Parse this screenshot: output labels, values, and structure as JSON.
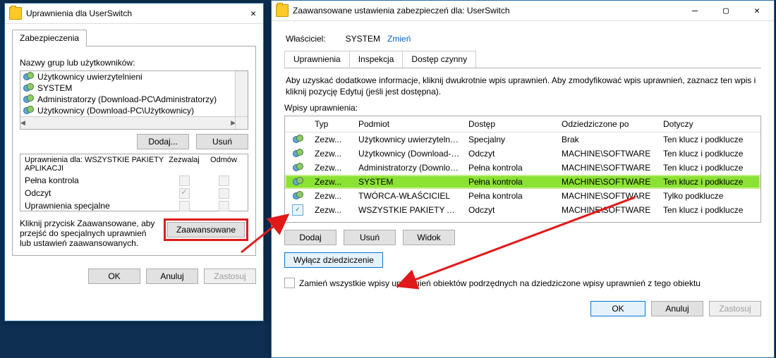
{
  "win1": {
    "title": "Uprawnienia dla UserSwitch",
    "tab": "Zabezpieczenia",
    "groups_label": "Nazwy grup lub użytkowników:",
    "groups": [
      "Użytkownicy uwierzytelnieni",
      "SYSTEM",
      "Administratorzy (Download-PC\\Administratorzy)",
      "Użytkownicy (Download-PC\\Użytkownicy)"
    ],
    "add_btn": "Dodaj...",
    "remove_btn": "Usuń",
    "perm_header": "Uprawnienia dla: WSZYSTKIE PAKIETY APLIKACJI",
    "allow": "Zezwalaj",
    "deny": "Odmów",
    "perm_rows": [
      {
        "name": "Pełna kontrola",
        "allow": false,
        "deny": false
      },
      {
        "name": "Odczyt",
        "allow": true,
        "deny": false
      },
      {
        "name": "Uprawnienia specjalne",
        "allow": false,
        "deny": false
      }
    ],
    "adv_text": "Kliknij przycisk Zaawansowane, aby przejść do specjalnych uprawnień lub ustawień zaawansowanych.",
    "adv_btn": "Zaawansowane",
    "ok": "OK",
    "cancel": "Anuluj",
    "apply": "Zastosuj"
  },
  "win2": {
    "title": "Zaawansowane ustawienia zabezpieczeń dla: UserSwitch",
    "owner_label": "Właściciel:",
    "owner_value": "SYSTEM",
    "change": "Zmień",
    "tabs": [
      "Uprawnienia",
      "Inspekcja",
      "Dostęp czynny"
    ],
    "info": "Aby uzyskać dodatkowe informacje, kliknij dwukrotnie wpis uprawnień. Aby zmodyfikować wpis uprawnień, zaznacz ten wpis i kliknij pozycję Edytuj (jeśli jest dostępna).",
    "entries_label": "Wpisy uprawnienia:",
    "cols": {
      "typ": "Typ",
      "pod": "Podmiot",
      "dos": "Dostęp",
      "odz": "Odziedziczone po",
      "dot": "Dotyczy"
    },
    "rows": [
      {
        "icon": "g",
        "typ": "Zezw...",
        "pod": "Użytkownicy uwierzytelnieni",
        "dos": "Specjalny",
        "odz": "Brak",
        "dot": "Ten klucz i podklucze",
        "sel": false
      },
      {
        "icon": "g",
        "typ": "Zezw...",
        "pod": "Użytkownicy (Download-PC\\...",
        "dos": "Odczyt",
        "odz": "MACHINE\\SOFTWARE",
        "dot": "Ten klucz i podklucze",
        "sel": false
      },
      {
        "icon": "g",
        "typ": "Zezw...",
        "pod": "Administratorzy (Download-P...",
        "dos": "Pełna kontrola",
        "odz": "MACHINE\\SOFTWARE",
        "dot": "Ten klucz i podklucze",
        "sel": false
      },
      {
        "icon": "g",
        "typ": "Zezw...",
        "pod": "SYSTEM",
        "dos": "Pełna kontrola",
        "odz": "MACHINE\\SOFTWARE",
        "dot": "Ten klucz i podklucze",
        "sel": true
      },
      {
        "icon": "g",
        "typ": "Zezw...",
        "pod": "TWÓRCA-WŁAŚCICIEL",
        "dos": "Pełna kontrola",
        "odz": "MACHINE\\SOFTWARE",
        "dot": "Tylko podklucze",
        "sel": false
      },
      {
        "icon": "p",
        "typ": "Zezw...",
        "pod": "WSZYSTKIE PAKIETY APLIKACJI",
        "dos": "Odczyt",
        "odz": "MACHINE\\SOFTWARE",
        "dot": "Ten klucz i podklucze",
        "sel": false
      }
    ],
    "add": "Dodaj",
    "remove": "Usuń",
    "view": "Widok",
    "disable_inherit": "Wyłącz dziedziczenie",
    "replace_chk": "Zamień wszystkie wpisy uprawnień obiektów podrzędnych na dziedziczone wpisy uprawnień z tego obiektu",
    "ok": "OK",
    "cancel": "Anuluj",
    "apply": "Zastosuj"
  }
}
